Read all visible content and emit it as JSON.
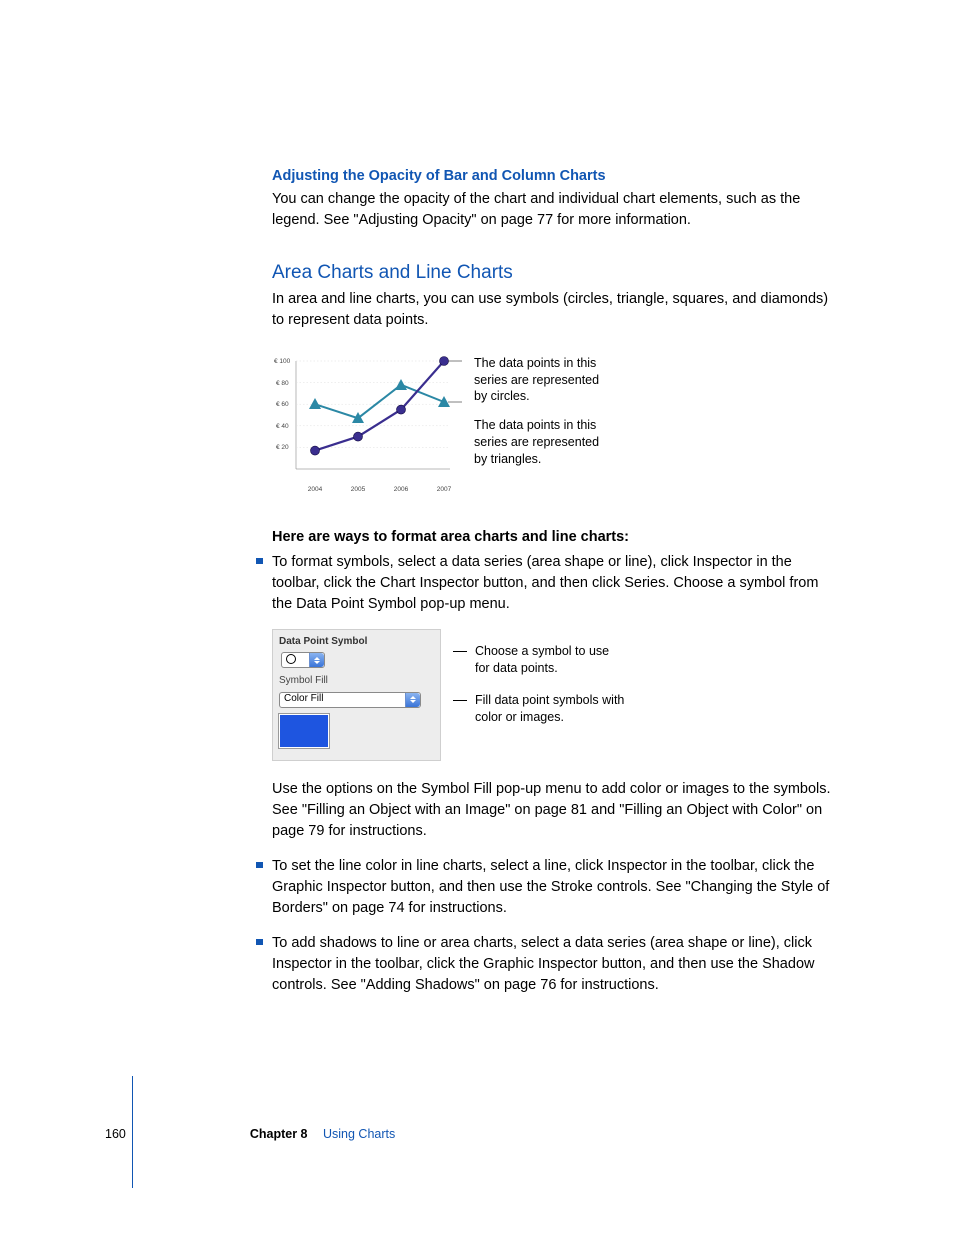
{
  "section1": {
    "heading": "Adjusting the Opacity of Bar and Column Charts",
    "para": "You can change the opacity of the chart and individual chart elements, such as the legend. See \"Adjusting Opacity\" on page 77 for more information."
  },
  "section2": {
    "heading": "Area Charts and Line Charts",
    "intro": "In area and line charts, you can use symbols (circles, triangle, squares, and diamonds) to represent data points."
  },
  "chart_data": {
    "type": "line",
    "x": [
      "2004",
      "2005",
      "2006",
      "2007"
    ],
    "y_ticks": [
      "€ 20",
      "€ 40",
      "€ 60",
      "€ 80",
      "€ 100"
    ],
    "ylim": [
      0,
      100
    ],
    "series": [
      {
        "name": "circles",
        "color": "#3a2e8f",
        "values": [
          17,
          30,
          55,
          100
        ],
        "marker": "circle"
      },
      {
        "name": "triangles",
        "color": "#2b88a5",
        "values": [
          60,
          47,
          78,
          62
        ],
        "marker": "triangle"
      }
    ],
    "callouts": [
      "The data points in this series are represented by circles.",
      "The data points in this series are represented by triangles."
    ]
  },
  "instructions": {
    "lead": "Here are ways to format area charts and line charts:",
    "items": [
      "To format symbols, select a data series (area shape or line), click Inspector in the toolbar, click the Chart Inspector button, and then click Series. Choose a symbol from the Data Point Symbol pop-up menu.",
      "To set the line color in line charts, select a line, click Inspector in the toolbar, click the Graphic Inspector button, and then use the Stroke controls. See \"Changing the Style of Borders\" on page 74 for instructions.",
      "To add shadows to line or area charts, select a data series (area shape or line), click Inspector in the toolbar, click the Graphic Inspector button, and then use the Shadow controls. See \"Adding Shadows\" on page 76 for instructions."
    ],
    "after_panel": "Use the options on the Symbol Fill pop-up menu to add color or images to the symbols. See \"Filling an Object with an Image\" on page 81 and \"Filling an Object with Color\" on page 79 for instructions."
  },
  "panel": {
    "label1": "Data Point Symbol",
    "label2": "Symbol Fill",
    "fill_value": "Color Fill",
    "callout1": "Choose a symbol to use for data points.",
    "callout2": "Fill data point symbols with color or images."
  },
  "footer": {
    "page": "160",
    "chapter": "Chapter 8",
    "title": "Using Charts"
  }
}
